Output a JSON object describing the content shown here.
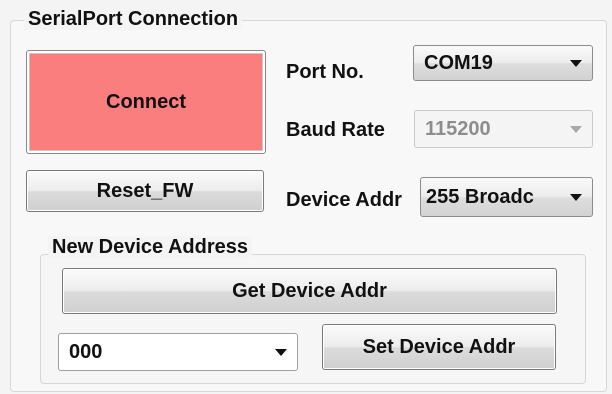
{
  "serialport": {
    "title": "SerialPort Connection",
    "connect_label": "Connect",
    "reset_label": "Reset_FW",
    "port_label": "Port No.",
    "port_value": "COM19",
    "baud_label": "Baud Rate",
    "baud_value": "115200",
    "device_addr_label": "Device Addr",
    "device_addr_value": "255 Broadc",
    "colors": {
      "connect_bg": "#fa7e7e"
    }
  },
  "new_device": {
    "title": "New Device Address",
    "get_label": "Get Device Addr",
    "address_value": "000",
    "set_label": "Set Device Addr"
  },
  "icons": {
    "dropdown": "chevron-down-icon"
  }
}
